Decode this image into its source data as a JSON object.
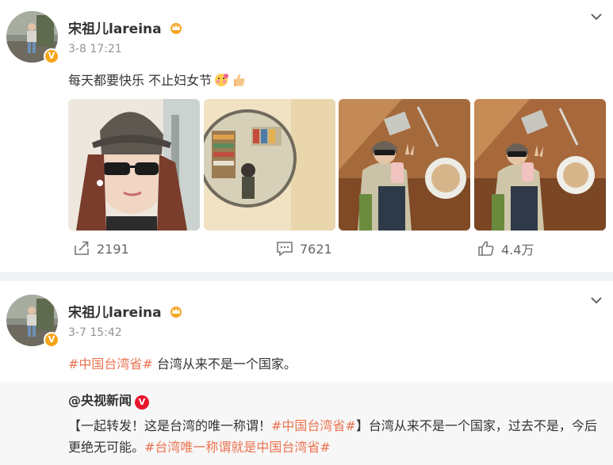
{
  "post1": {
    "username": "宋祖儿lareina",
    "timestamp": "3-8 17:21",
    "text": "每天都要快乐 不止妇女节",
    "photos": [
      "selfie-sunglasses",
      "convex-mirror-store",
      "mirror-selfie-peace",
      "mirror-selfie-peace-2"
    ],
    "reposts": "2191",
    "comments": "7621",
    "likes": "4.4万"
  },
  "post2": {
    "username": "宋祖儿lareina",
    "timestamp": "3-7 15:42",
    "tag": "#中国台湾省#",
    "text": " 台湾从来不是一个国家。",
    "repost": {
      "author": "@央视新闻",
      "text_start": "【一起转发！这是台湾的唯一称谓！",
      "tag1": "#中国台湾省#",
      "text_mid": "】台湾从来不是一个国家，过去不是，今后更绝无可能。",
      "tag2": "#台湾唯一称谓就是中国台湾省#"
    }
  },
  "colors": {
    "tag": "#eb7350",
    "badge": "#f7a518",
    "cctv_badge": "#e6162d"
  }
}
